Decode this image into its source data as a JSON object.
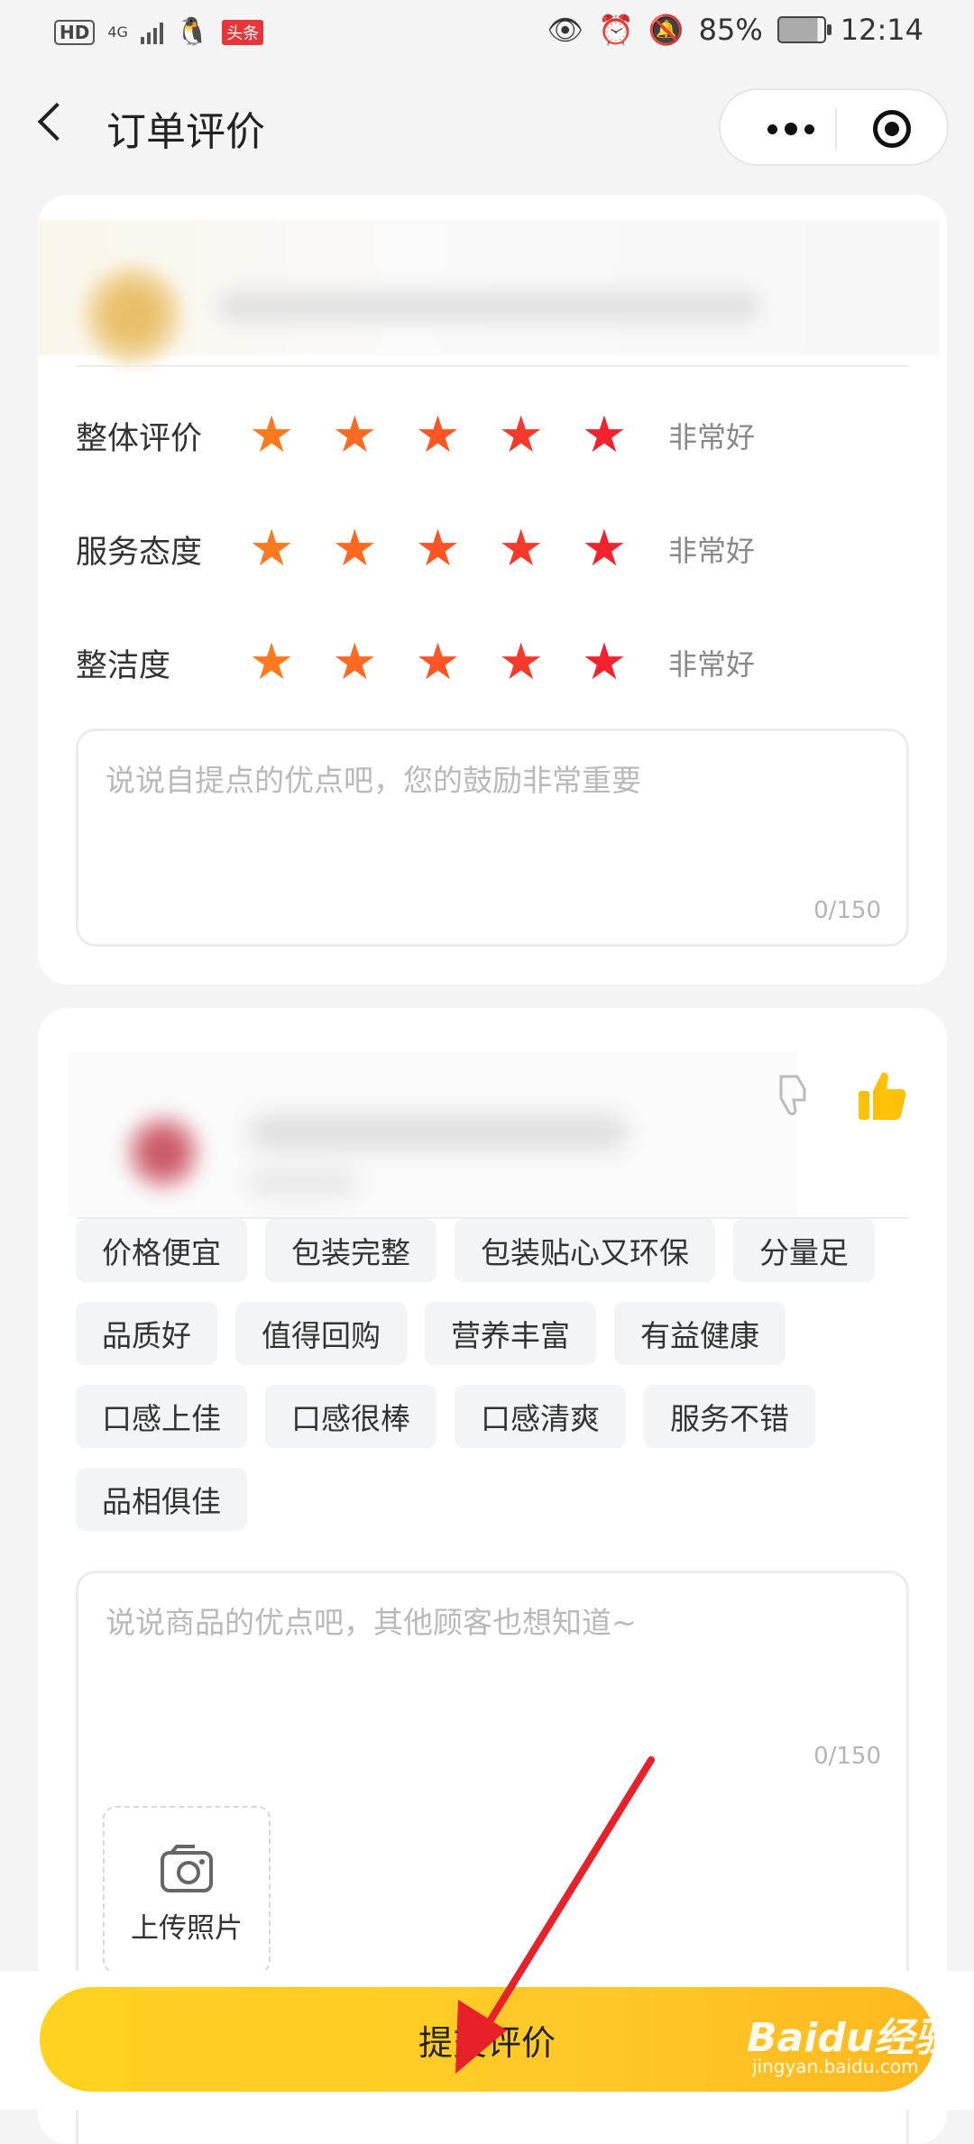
{
  "status_bar": {
    "hd": "HD",
    "network": "4G",
    "toutiao": "头条",
    "battery": "85%",
    "time": "12:14"
  },
  "nav": {
    "title": "订单评价"
  },
  "service_card": {
    "ratings": [
      {
        "label": "整体评价",
        "stars": 5,
        "text": "非常好"
      },
      {
        "label": "服务态度",
        "stars": 5,
        "text": "非常好"
      },
      {
        "label": "整洁度",
        "stars": 5,
        "text": "非常好"
      }
    ],
    "comment": {
      "placeholder": "说说自提点的优点吧，您的鼓励非常重要",
      "count": "0/150"
    }
  },
  "product_card": {
    "tags": [
      "价格便宜",
      "包装完整",
      "包装贴心又环保",
      "分量足",
      "品质好",
      "值得回购",
      "营养丰富",
      "有益健康",
      "口感上佳",
      "口感很棒",
      "口感清爽",
      "服务不错",
      "品相俱佳"
    ],
    "comment": {
      "placeholder": "说说商品的优点吧，其他顾客也想知道~",
      "count": "0/150"
    },
    "upload_label": "上传照片"
  },
  "submit_label": "提交评价",
  "watermark": {
    "main": "Baidu经验",
    "sub": "jingyan.baidu.com"
  },
  "colors": {
    "star_gradient": [
      "#ff7a1f",
      "#ff6a22",
      "#ff5525",
      "#f73a2c",
      "#f2222f"
    ],
    "submit": "#ffc928",
    "thumb_up": "#ffc107",
    "arrow": "#e8202a"
  }
}
